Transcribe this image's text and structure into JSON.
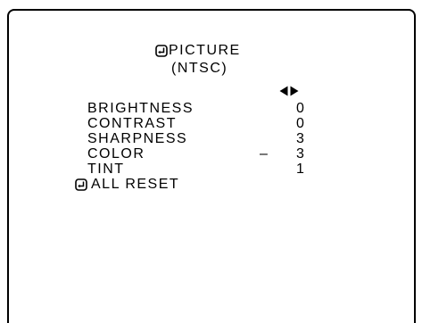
{
  "menu": {
    "title": "PICTURE",
    "subtitle": "(NTSC)",
    "items": [
      {
        "label": "BRIGHTNESS",
        "sign": "",
        "value": "0"
      },
      {
        "label": "CONTRAST",
        "sign": "",
        "value": "0"
      },
      {
        "label": "SHARPNESS",
        "sign": "",
        "value": "3"
      },
      {
        "label": "COLOR",
        "sign": "–",
        "value": "3"
      },
      {
        "label": "TINT",
        "sign": "",
        "value": "1"
      }
    ],
    "reset_label": "ALL RESET"
  },
  "icons": {
    "title_icon": "enter-icon",
    "adjust_icon": "left-right-arrows-icon",
    "reset_icon": "enter-icon"
  }
}
